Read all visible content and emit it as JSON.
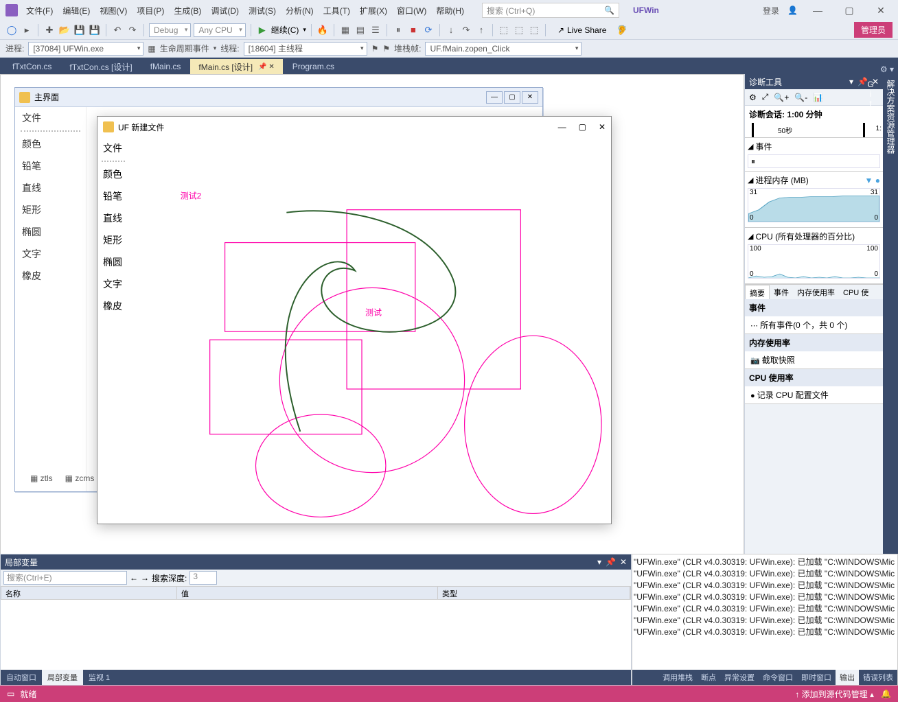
{
  "menu": [
    "文件(F)",
    "编辑(E)",
    "视图(V)",
    "项目(P)",
    "生成(B)",
    "调试(D)",
    "测试(S)",
    "分析(N)",
    "工具(T)",
    "扩展(X)",
    "窗口(W)",
    "帮助(H)"
  ],
  "search_placeholder": "搜索 (Ctrl+Q)",
  "brand": "UFWin",
  "login": "登录",
  "toolbar": {
    "config": "Debug",
    "platform": "Any CPU",
    "continue": "继续(C)",
    "liveshare": "Live Share",
    "admin": "管理员"
  },
  "procbar": {
    "process_label": "进程:",
    "process_value": "[37084] UFWin.exe",
    "lifecycle": "生命周期事件",
    "thread_label": "线程:",
    "thread_value": "[18604] 主线程",
    "stack_label": "堆栈帧:",
    "stack_value": "UF.fMain.zopen_Click"
  },
  "tabs": {
    "items": [
      "fTxtCon.cs",
      "fTxtCon.cs [设计]",
      "fMain.cs",
      "fMain.cs [设计]",
      "Program.cs"
    ],
    "active": 3
  },
  "mdi": {
    "title": "主界面",
    "menu_first": "文件",
    "tools": [
      "颜色",
      "铅笔",
      "直线",
      "矩形",
      "椭圆",
      "文字",
      "橡皮"
    ]
  },
  "popup": {
    "title": "UF 新建文件",
    "menu_first": "文件",
    "tools": [
      "颜色",
      "铅笔",
      "直线",
      "矩形",
      "椭圆",
      "文字",
      "橡皮"
    ],
    "text1": "测试2",
    "text2": "测试"
  },
  "zicons": {
    "a": "ztls",
    "b": "zcms"
  },
  "diag": {
    "title": "诊断工具",
    "session": "诊断会话: 1:00 分钟",
    "timeline_label": "50秒",
    "timeline_label2": "1:",
    "events_title": "事件",
    "mem_title": "进程内存 (MB)",
    "mem_max": "31",
    "mem_min": "0",
    "cpu_title": "CPU (所有处理器的百分比)",
    "cpu_max": "100",
    "cpu_min": "0",
    "tabs": [
      "摘要",
      "事件",
      "内存使用率",
      "CPU 使"
    ],
    "events_panel": "事件",
    "events_line": "所有事件(0 个，共 0 个)",
    "mem_panel": "内存使用率",
    "mem_line": "截取快照",
    "cpu_panel": "CPU 使用率",
    "cpu_line": "记录 CPU 配置文件"
  },
  "sidetabs": [
    "解决方案资源管理器",
    "Git 更改"
  ],
  "vars": {
    "title": "局部变量",
    "search_placeholder": "搜索(Ctrl+E)",
    "depth_label": "搜索深度:",
    "depth_value": "3",
    "cols": [
      "名称",
      "值",
      "类型"
    ],
    "btabs": [
      "自动窗口",
      "局部变量",
      "监视 1"
    ]
  },
  "output": {
    "lines": [
      "\"UFWin.exe\" (CLR v4.0.30319: UFWin.exe): 已加载 \"C:\\WINDOWS\\Mic",
      "\"UFWin.exe\" (CLR v4.0.30319: UFWin.exe): 已加载 \"C:\\WINDOWS\\Mic",
      "\"UFWin.exe\" (CLR v4.0.30319: UFWin.exe): 已加载 \"C:\\WINDOWS\\Mic",
      "\"UFWin.exe\" (CLR v4.0.30319: UFWin.exe): 已加载 \"C:\\WINDOWS\\Mic",
      "\"UFWin.exe\" (CLR v4.0.30319: UFWin.exe): 已加载 \"C:\\WINDOWS\\Mic",
      "\"UFWin.exe\" (CLR v4.0.30319: UFWin.exe): 已加载 \"C:\\WINDOWS\\Mic",
      "\"UFWin.exe\" (CLR v4.0.30319: UFWin.exe): 已加载 \"C:\\WINDOWS\\Mic"
    ],
    "otabs": [
      "调用堆栈",
      "断点",
      "异常设置",
      "命令窗口",
      "即时窗口",
      "输出",
      "错误列表"
    ]
  },
  "status": {
    "ready": "就绪",
    "source": "添加到源代码管理"
  },
  "chart_data": [
    {
      "type": "area",
      "title": "进程内存 (MB)",
      "ylim": [
        0,
        31
      ],
      "series": [
        {
          "name": "memory",
          "values": [
            8,
            12,
            20,
            24,
            25,
            25,
            26,
            26,
            26,
            27,
            27,
            27,
            27
          ]
        }
      ]
    },
    {
      "type": "line",
      "title": "CPU (所有处理器的百分比)",
      "ylim": [
        0,
        100
      ],
      "series": [
        {
          "name": "cpu",
          "values": [
            0,
            4,
            1,
            2,
            8,
            1,
            0,
            3,
            0,
            1,
            0,
            2,
            0
          ]
        }
      ]
    }
  ]
}
